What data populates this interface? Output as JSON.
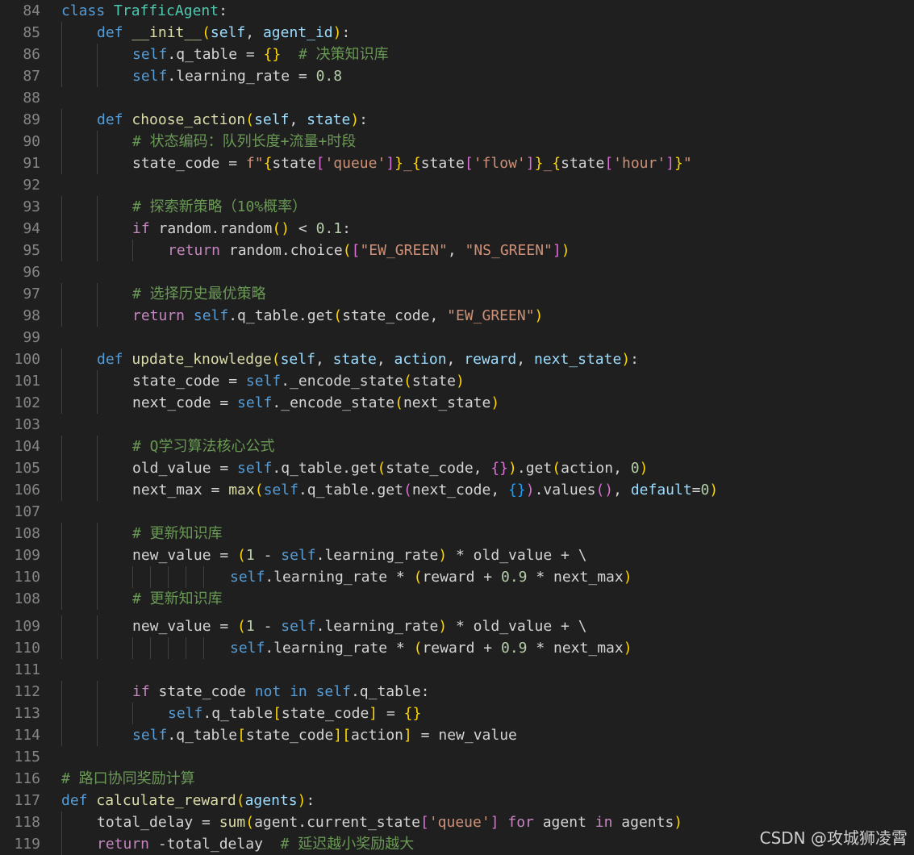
{
  "lines": [
    {
      "n": "84",
      "i": 0,
      "t": [
        [
          "class ",
          "k"
        ],
        [
          "TrafficAgent",
          "cls"
        ],
        [
          ":",
          "op"
        ]
      ]
    },
    {
      "n": "85",
      "i": 1,
      "t": [
        [
          "def ",
          "k"
        ],
        [
          "__init__",
          "fn"
        ],
        [
          "(",
          "b1"
        ],
        [
          "self",
          "var"
        ],
        [
          ", ",
          "op"
        ],
        [
          "agent_id",
          "var"
        ],
        [
          ")",
          "b1"
        ],
        [
          ":",
          "op"
        ]
      ]
    },
    {
      "n": "86",
      "i": 2,
      "t": [
        [
          "self",
          "self"
        ],
        [
          ".q_table = ",
          "op"
        ],
        [
          "{}",
          "b1"
        ],
        [
          "  ",
          "op"
        ],
        [
          "# 决策知识库",
          "com"
        ]
      ]
    },
    {
      "n": "87",
      "i": 2,
      "t": [
        [
          "self",
          "self"
        ],
        [
          ".learning_rate = ",
          "op"
        ],
        [
          "0.8",
          "num"
        ]
      ]
    },
    {
      "n": "88",
      "i": 0,
      "t": []
    },
    {
      "n": "89",
      "i": 1,
      "t": [
        [
          "def ",
          "k"
        ],
        [
          "choose_action",
          "fn"
        ],
        [
          "(",
          "b1"
        ],
        [
          "self",
          "var"
        ],
        [
          ", ",
          "op"
        ],
        [
          "state",
          "var"
        ],
        [
          ")",
          "b1"
        ],
        [
          ":",
          "op"
        ]
      ]
    },
    {
      "n": "90",
      "i": 2,
      "t": [
        [
          "# 状态编码：队列长度+流量+时段",
          "com"
        ]
      ]
    },
    {
      "n": "91",
      "i": 2,
      "t": [
        [
          "state_code = ",
          "op"
        ],
        [
          "f\"",
          "str"
        ],
        [
          "{",
          "b1"
        ],
        [
          "state",
          "op"
        ],
        [
          "[",
          "b2"
        ],
        [
          "'queue'",
          "str"
        ],
        [
          "]",
          "b2"
        ],
        [
          "}",
          "b1"
        ],
        [
          "_",
          "str"
        ],
        [
          "{",
          "b1"
        ],
        [
          "state",
          "op"
        ],
        [
          "[",
          "b2"
        ],
        [
          "'flow'",
          "str"
        ],
        [
          "]",
          "b2"
        ],
        [
          "}",
          "b1"
        ],
        [
          "_",
          "str"
        ],
        [
          "{",
          "b1"
        ],
        [
          "state",
          "op"
        ],
        [
          "[",
          "b2"
        ],
        [
          "'hour'",
          "str"
        ],
        [
          "]",
          "b2"
        ],
        [
          "}",
          "b1"
        ],
        [
          "\"",
          "str"
        ]
      ]
    },
    {
      "n": "92",
      "i": 0,
      "t": []
    },
    {
      "n": "93",
      "i": 2,
      "t": [
        [
          "# 探索新策略（10%概率）",
          "com"
        ]
      ]
    },
    {
      "n": "94",
      "i": 2,
      "t": [
        [
          "if ",
          "kc"
        ],
        [
          "random.random",
          "op"
        ],
        [
          "()",
          "b1"
        ],
        [
          " < ",
          "op"
        ],
        [
          "0.1",
          "num"
        ],
        [
          ":",
          "op"
        ]
      ]
    },
    {
      "n": "95",
      "i": 3,
      "t": [
        [
          "return ",
          "kc"
        ],
        [
          "random.choice",
          "op"
        ],
        [
          "(",
          "b1"
        ],
        [
          "[",
          "b2"
        ],
        [
          "\"EW_GREEN\"",
          "str"
        ],
        [
          ", ",
          "op"
        ],
        [
          "\"NS_GREEN\"",
          "str"
        ],
        [
          "]",
          "b2"
        ],
        [
          ")",
          "b1"
        ]
      ]
    },
    {
      "n": "96",
      "i": 0,
      "t": []
    },
    {
      "n": "97",
      "i": 2,
      "t": [
        [
          "# 选择历史最优策略",
          "com"
        ]
      ]
    },
    {
      "n": "98",
      "i": 2,
      "t": [
        [
          "return ",
          "kc"
        ],
        [
          "self",
          "self"
        ],
        [
          ".q_table.get",
          "op"
        ],
        [
          "(",
          "b1"
        ],
        [
          "state_code, ",
          "op"
        ],
        [
          "\"EW_GREEN\"",
          "str"
        ],
        [
          ")",
          "b1"
        ]
      ]
    },
    {
      "n": "99",
      "i": 0,
      "t": []
    },
    {
      "n": "100",
      "i": 1,
      "t": [
        [
          "def ",
          "k"
        ],
        [
          "update_knowledge",
          "fn"
        ],
        [
          "(",
          "b1"
        ],
        [
          "self",
          "var"
        ],
        [
          ", ",
          "op"
        ],
        [
          "state",
          "var"
        ],
        [
          ", ",
          "op"
        ],
        [
          "action",
          "var"
        ],
        [
          ", ",
          "op"
        ],
        [
          "reward",
          "var"
        ],
        [
          ", ",
          "op"
        ],
        [
          "next_state",
          "var"
        ],
        [
          ")",
          "b1"
        ],
        [
          ":",
          "op"
        ]
      ]
    },
    {
      "n": "101",
      "i": 2,
      "t": [
        [
          "state_code = ",
          "op"
        ],
        [
          "self",
          "self"
        ],
        [
          "._encode_state",
          "op"
        ],
        [
          "(",
          "b1"
        ],
        [
          "state",
          "op"
        ],
        [
          ")",
          "b1"
        ]
      ]
    },
    {
      "n": "102",
      "i": 2,
      "t": [
        [
          "next_code = ",
          "op"
        ],
        [
          "self",
          "self"
        ],
        [
          "._encode_state",
          "op"
        ],
        [
          "(",
          "b1"
        ],
        [
          "next_state",
          "op"
        ],
        [
          ")",
          "b1"
        ]
      ]
    },
    {
      "n": "103",
      "i": 0,
      "t": []
    },
    {
      "n": "104",
      "i": 2,
      "t": [
        [
          "# Q学习算法核心公式",
          "com"
        ]
      ]
    },
    {
      "n": "105",
      "i": 2,
      "t": [
        [
          "old_value = ",
          "op"
        ],
        [
          "self",
          "self"
        ],
        [
          ".q_table.get",
          "op"
        ],
        [
          "(",
          "b1"
        ],
        [
          "state_code, ",
          "op"
        ],
        [
          "{}",
          "b2"
        ],
        [
          ")",
          "b1"
        ],
        [
          ".get",
          "op"
        ],
        [
          "(",
          "b1"
        ],
        [
          "action, ",
          "op"
        ],
        [
          "0",
          "num"
        ],
        [
          ")",
          "b1"
        ]
      ]
    },
    {
      "n": "106",
      "i": 2,
      "t": [
        [
          "next_max = ",
          "op"
        ],
        [
          "max",
          "fn"
        ],
        [
          "(",
          "b1"
        ],
        [
          "self",
          "self"
        ],
        [
          ".q_table.get",
          "op"
        ],
        [
          "(",
          "b2"
        ],
        [
          "next_code, ",
          "op"
        ],
        [
          "{}",
          "b3"
        ],
        [
          ")",
          "b2"
        ],
        [
          ".values",
          "op"
        ],
        [
          "()",
          "b2"
        ],
        [
          ", ",
          "op"
        ],
        [
          "default",
          "var"
        ],
        [
          "=",
          "op"
        ],
        [
          "0",
          "num"
        ],
        [
          ")",
          "b1"
        ]
      ]
    },
    {
      "n": "107",
      "i": 0,
      "t": []
    },
    {
      "n": "108",
      "i": 2,
      "t": [
        [
          "# 更新知识库",
          "com"
        ]
      ]
    },
    {
      "n": "109",
      "i": 2,
      "t": [
        [
          "new_value = ",
          "op"
        ],
        [
          "(",
          "b1"
        ],
        [
          "1",
          "num"
        ],
        [
          " - ",
          "op"
        ],
        [
          "self",
          "self"
        ],
        [
          ".learning_rate",
          "op"
        ],
        [
          ")",
          "b1"
        ],
        [
          " * old_value + \\",
          "op"
        ]
      ]
    },
    {
      "n": "110",
      "i": 2,
      "x": 5,
      "t": [
        [
          "self",
          "self"
        ],
        [
          ".learning_rate * ",
          "op"
        ],
        [
          "(",
          "b1"
        ],
        [
          "reward + ",
          "op"
        ],
        [
          "0.9",
          "num"
        ],
        [
          " * next_max",
          "op"
        ],
        [
          ")",
          "b1"
        ]
      ]
    },
    {
      "n": "108",
      "i": 2,
      "t": [
        [
          "# 更新知识库",
          "com"
        ]
      ]
    },
    {
      "n": "109",
      "i": 2,
      "t": [
        [
          "new_value = ",
          "op"
        ],
        [
          "(",
          "b1"
        ],
        [
          "1",
          "num"
        ],
        [
          " - ",
          "op"
        ],
        [
          "self",
          "self"
        ],
        [
          ".learning_rate",
          "op"
        ],
        [
          ")",
          "b1"
        ],
        [
          " * old_value + \\",
          "op"
        ]
      ]
    },
    {
      "n": "110",
      "i": 2,
      "x": 5,
      "t": [
        [
          "self",
          "self"
        ],
        [
          ".learning_rate * ",
          "op"
        ],
        [
          "(",
          "b1"
        ],
        [
          "reward + ",
          "op"
        ],
        [
          "0.9",
          "num"
        ],
        [
          " * next_max",
          "op"
        ],
        [
          ")",
          "b1"
        ]
      ]
    },
    {
      "n": "111",
      "i": 0,
      "t": []
    },
    {
      "n": "112",
      "i": 2,
      "t": [
        [
          "if ",
          "kc"
        ],
        [
          "state_code ",
          "op"
        ],
        [
          "not in ",
          "k"
        ],
        [
          "self",
          "self"
        ],
        [
          ".q_table:",
          "op"
        ]
      ]
    },
    {
      "n": "113",
      "i": 3,
      "t": [
        [
          "self",
          "self"
        ],
        [
          ".q_table",
          "op"
        ],
        [
          "[",
          "b1"
        ],
        [
          "state_code",
          "op"
        ],
        [
          "]",
          "b1"
        ],
        [
          " = ",
          "op"
        ],
        [
          "{}",
          "b1"
        ]
      ]
    },
    {
      "n": "114",
      "i": 2,
      "t": [
        [
          "self",
          "self"
        ],
        [
          ".q_table",
          "op"
        ],
        [
          "[",
          "b1"
        ],
        [
          "state_code",
          "op"
        ],
        [
          "]",
          "b1"
        ],
        [
          "[",
          "b1"
        ],
        [
          "action",
          "op"
        ],
        [
          "]",
          "b1"
        ],
        [
          " = new_value",
          "op"
        ]
      ]
    },
    {
      "n": "115",
      "i": 0,
      "t": []
    },
    {
      "n": "116",
      "i": 0,
      "t": [
        [
          "# 路口协同奖励计算",
          "com"
        ]
      ]
    },
    {
      "n": "117",
      "i": 0,
      "t": [
        [
          "def ",
          "k"
        ],
        [
          "calculate_reward",
          "fn"
        ],
        [
          "(",
          "b1"
        ],
        [
          "agents",
          "var"
        ],
        [
          ")",
          "b1"
        ],
        [
          ":",
          "op"
        ]
      ]
    },
    {
      "n": "118",
      "i": 1,
      "t": [
        [
          "total_delay = ",
          "op"
        ],
        [
          "sum",
          "fn"
        ],
        [
          "(",
          "b1"
        ],
        [
          "agent.current_state",
          "op"
        ],
        [
          "[",
          "b2"
        ],
        [
          "'queue'",
          "str"
        ],
        [
          "]",
          "b2"
        ],
        [
          " for ",
          "kc"
        ],
        [
          "agent ",
          "op"
        ],
        [
          "in ",
          "kc"
        ],
        [
          "agents",
          "op"
        ],
        [
          ")",
          "b1"
        ]
      ]
    },
    {
      "n": "119",
      "i": 1,
      "t": [
        [
          "return ",
          "kc"
        ],
        [
          "-total_delay",
          "op"
        ],
        [
          "  ",
          "op"
        ],
        [
          "# 延迟越小奖励越大",
          "com"
        ]
      ]
    }
  ],
  "watermark": "CSDN @攻城狮凌霄"
}
